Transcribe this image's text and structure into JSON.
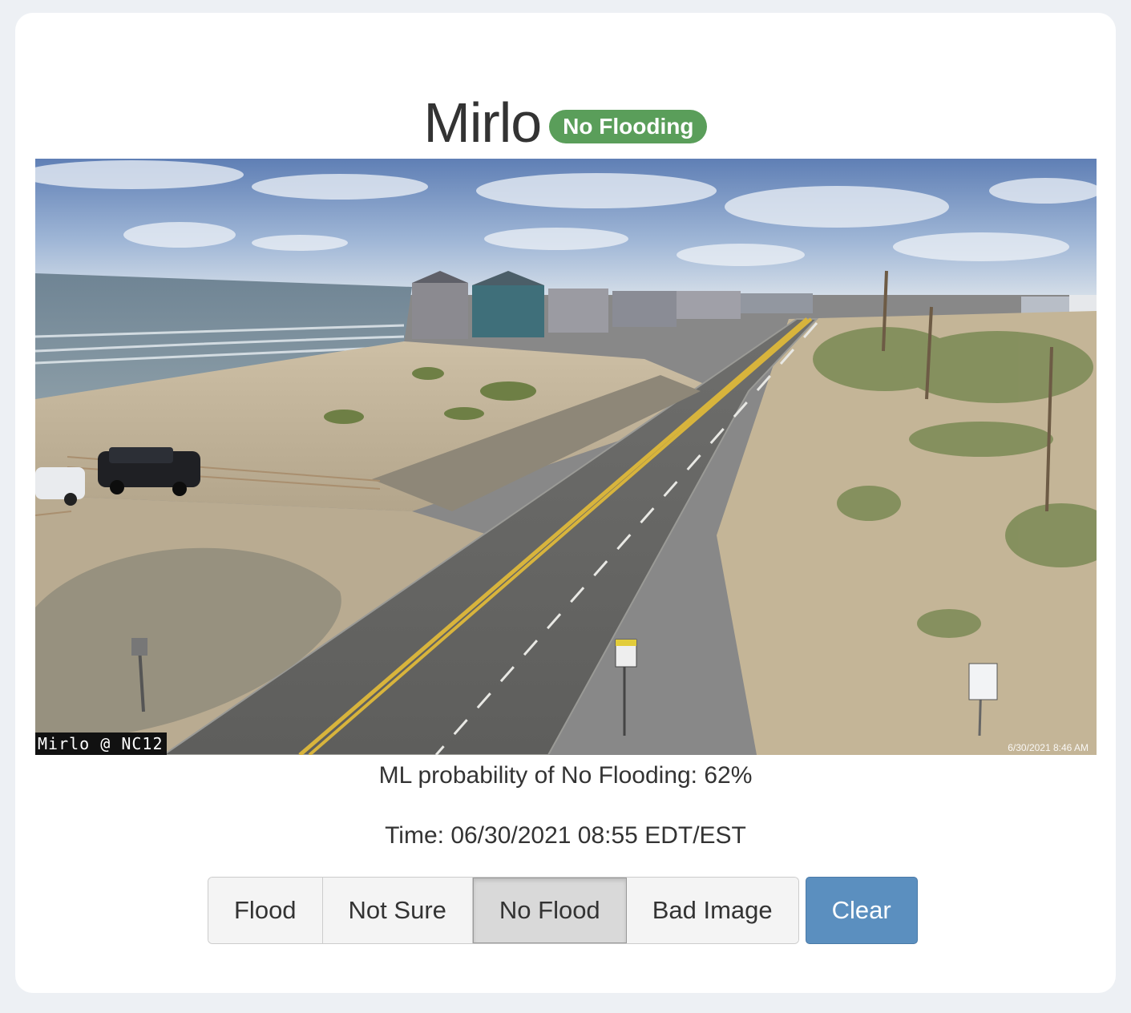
{
  "site": {
    "name": "Mirlo",
    "status_badge": "No Flooding"
  },
  "camera": {
    "overlay_label": "Mirlo @ NC12",
    "timestamp_stamp": "6/30/2021 8:46 AM"
  },
  "prediction": {
    "probability_text": "ML probability of No Flooding: 62%"
  },
  "time": {
    "text": "Time: 06/30/2021 08:55 EDT/EST"
  },
  "labels": {
    "options": [
      "Flood",
      "Not Sure",
      "No Flood",
      "Bad Image"
    ],
    "selected": "No Flood",
    "clear_label": "Clear"
  },
  "colors": {
    "badge": "#5a9e5a",
    "clear_button": "#5b8fbf",
    "page_bg": "#edf0f4"
  }
}
